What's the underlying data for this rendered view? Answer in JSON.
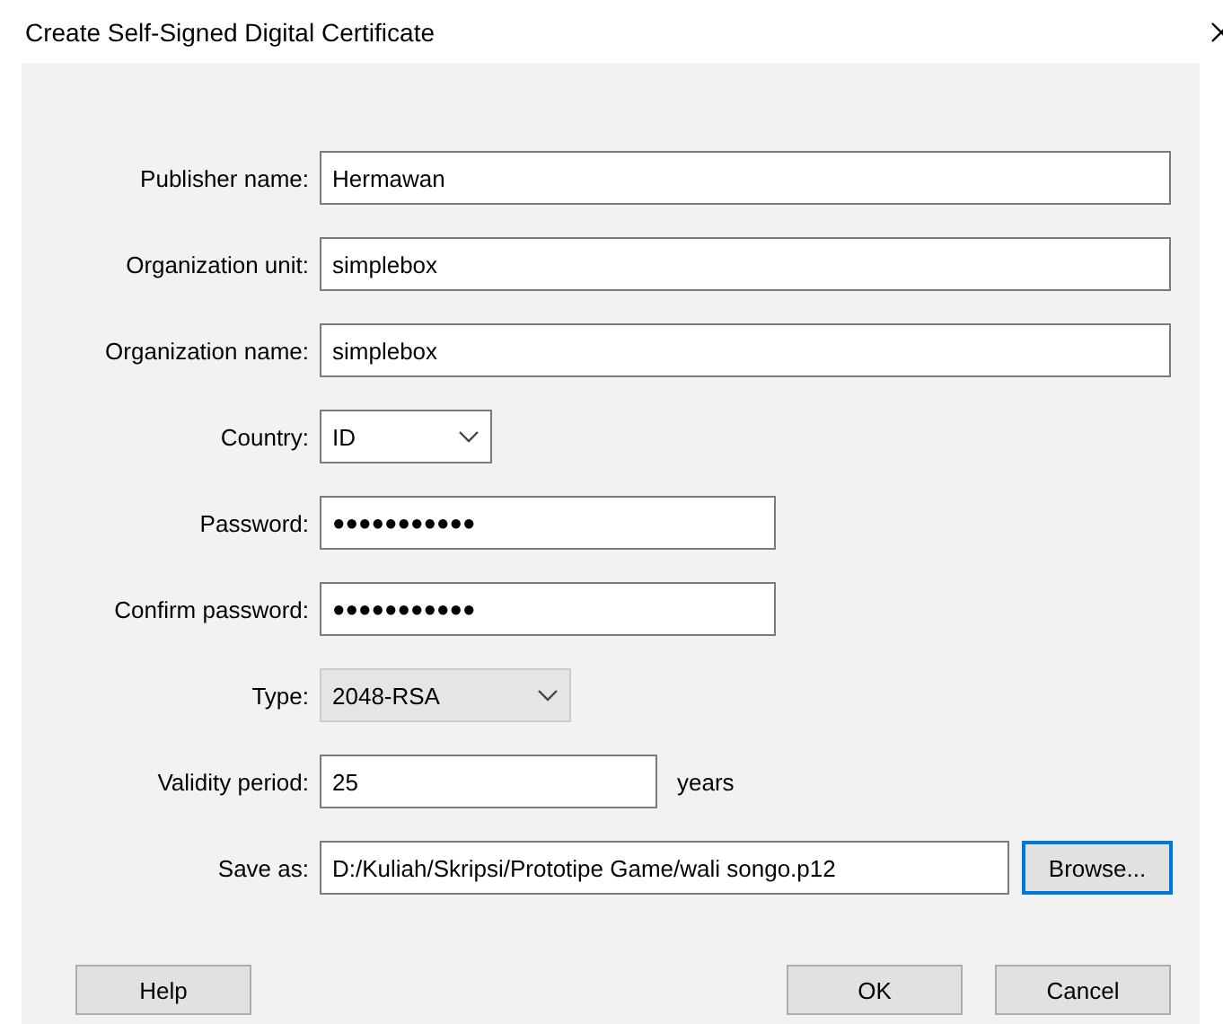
{
  "window": {
    "title": "Create Self-Signed Digital Certificate"
  },
  "fields": [
    {
      "kind": "text",
      "label": "Publisher name:",
      "value": "Hermawan"
    },
    {
      "kind": "text",
      "label": "Organization unit:",
      "value": "simplebox"
    },
    {
      "kind": "text",
      "label": "Organization name:",
      "value": "simplebox"
    },
    {
      "kind": "select",
      "label": "Country:",
      "value": "ID",
      "disabled": false
    },
    {
      "kind": "password",
      "label": "Password:",
      "value": "●●●●●●●●●●●"
    },
    {
      "kind": "password",
      "label": "Confirm password:",
      "value": "●●●●●●●●●●●"
    },
    {
      "kind": "select",
      "label": "Type:",
      "value": "2048-RSA",
      "disabled": true
    },
    {
      "kind": "text",
      "label": "Validity period:",
      "value": "25",
      "suffix": "years"
    },
    {
      "kind": "file",
      "label": "Save as:",
      "value": "D:/Kuliah/Skripsi/Prototipe Game/wali songo.p12",
      "button": {
        "label": "Browse...",
        "focused": true
      }
    }
  ],
  "buttons": [
    {
      "label": "Help"
    },
    {
      "label": "OK"
    },
    {
      "label": "Cancel"
    }
  ]
}
